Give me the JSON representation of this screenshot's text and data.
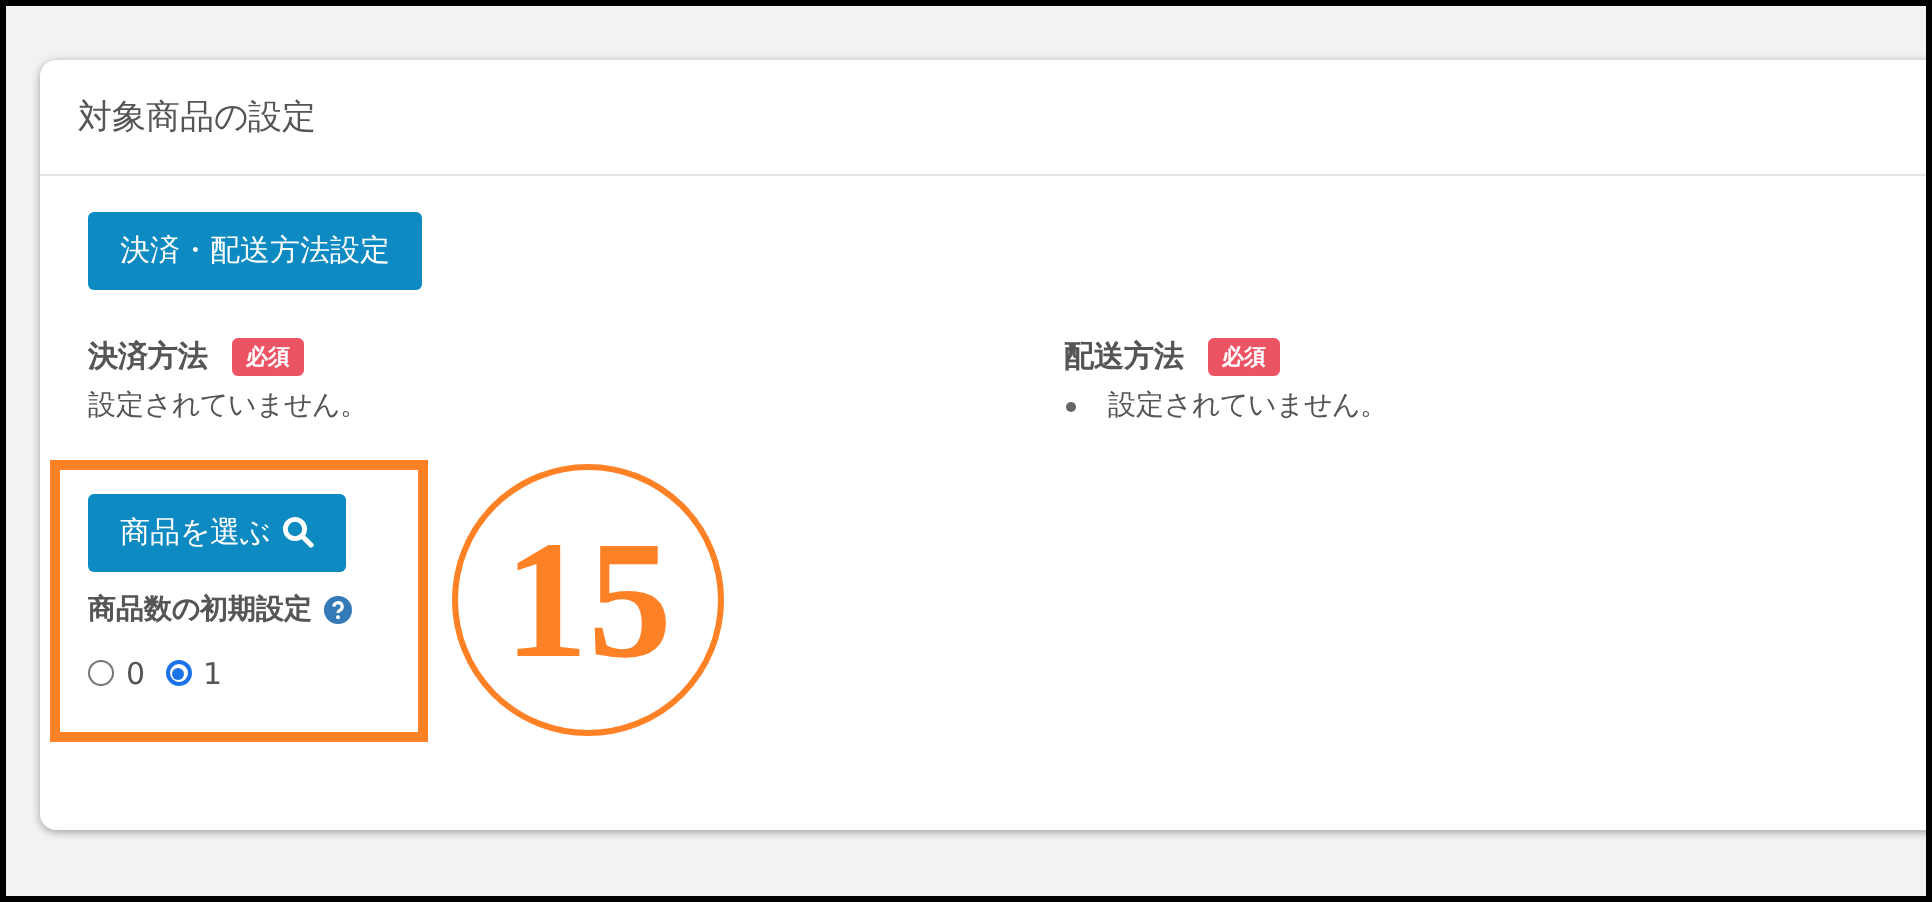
{
  "card": {
    "title": "対象商品の設定"
  },
  "settings_button": "決済・配送方法設定",
  "payment": {
    "label": "決済方法",
    "badge": "必須",
    "value": "設定されていません。"
  },
  "shipping": {
    "label": "配送方法",
    "badge": "必須",
    "items": [
      "設定されていません。"
    ]
  },
  "select_button": "商品を選ぶ",
  "quantity": {
    "label": "商品数の初期設定",
    "options": [
      {
        "label": "0",
        "selected": false
      },
      {
        "label": "1",
        "selected": true
      }
    ]
  },
  "annotation": {
    "number": "15"
  }
}
